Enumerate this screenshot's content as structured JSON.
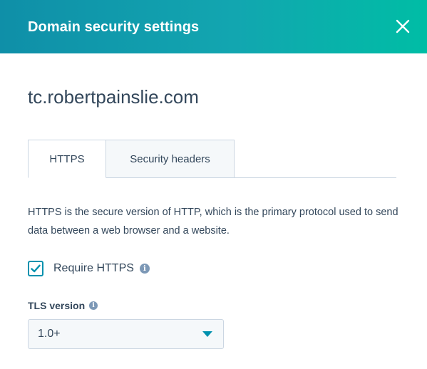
{
  "dialog": {
    "title": "Domain security settings",
    "close_icon": "close-icon"
  },
  "domain": {
    "name": "tc.robertpainslie.com"
  },
  "tabs": [
    {
      "label": "HTTPS",
      "active": true
    },
    {
      "label": "Security headers",
      "active": false
    }
  ],
  "https": {
    "description": "HTTPS is the secure version of HTTP, which is the primary protocol used to send data between a web browser and a website.",
    "require_https": {
      "label": "Require HTTPS",
      "checked": true,
      "icon": "info-icon"
    },
    "tls": {
      "label": "TLS version",
      "icon": "info-icon",
      "selected": "1.0+"
    }
  },
  "colors": {
    "header_start": "#0f8fa8",
    "header_end": "#00bda5",
    "text": "#33475b",
    "accent": "#0091ae",
    "caret": "#0091ae",
    "info_icon": "#7c98b6",
    "border": "#cbd6e2"
  }
}
